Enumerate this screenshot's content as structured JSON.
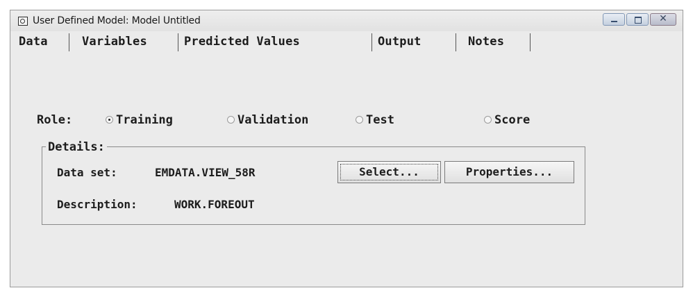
{
  "window": {
    "title": "User Defined Model: Model Untitled"
  },
  "tabs": [
    {
      "label": "Data"
    },
    {
      "label": "Variables"
    },
    {
      "label": "Predicted Values"
    },
    {
      "label": "Output"
    },
    {
      "label": "Notes"
    }
  ],
  "role": {
    "label": "Role:",
    "options": [
      {
        "label": "Training",
        "selected": true
      },
      {
        "label": "Validation",
        "selected": false
      },
      {
        "label": "Test",
        "selected": false
      },
      {
        "label": "Score",
        "selected": false
      }
    ]
  },
  "details": {
    "legend": "Details:",
    "data_set_label": "Data set:",
    "data_set_value": "EMDATA.VIEW_58R",
    "description_label": "Description:",
    "description_value": "WORK.FOREOUT",
    "select_button": "Select...",
    "properties_button": "Properties..."
  }
}
